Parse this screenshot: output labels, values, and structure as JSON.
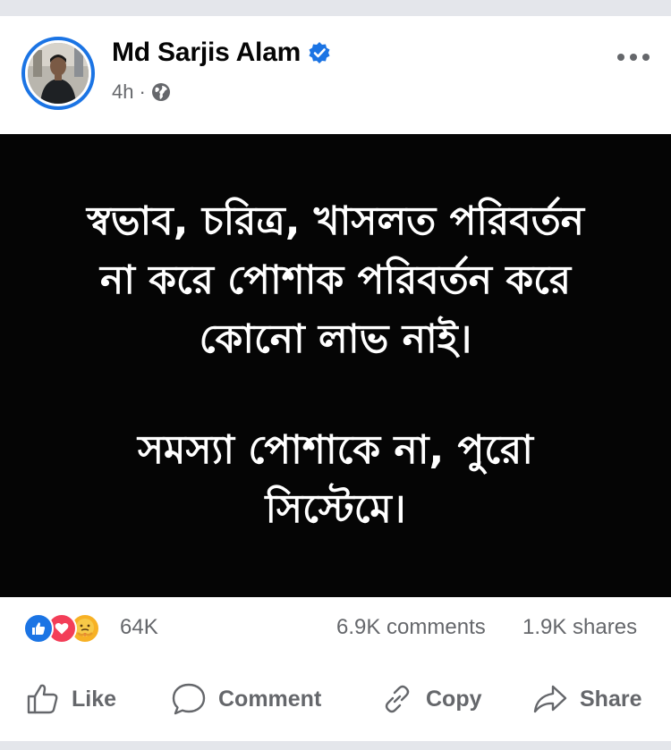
{
  "post": {
    "author": {
      "name": "Md Sarjis Alam",
      "verified": true,
      "avatar_icon": "profile-photo"
    },
    "time": "4h",
    "separator": "·",
    "audience_icon": "globe-icon",
    "more_icon": "more-dots-icon",
    "image_text": {
      "paragraph1": "স্বভাব, চরিত্র, খাসলত পরিবর্তন\nনা করে পোশাক পরিবর্তন করে\nকোনো লাভ নাই।",
      "paragraph2": "সমস্যা পোশাকে না, পুরো\nসিস্টেমে।"
    },
    "image_colors": {
      "background": "#050505",
      "text": "#ffffff"
    }
  },
  "stats": {
    "reactions": [
      "like-icon",
      "love-icon",
      "care-icon"
    ],
    "reaction_count": "64K",
    "comments": "6.9K comments",
    "shares": "1.9K shares"
  },
  "actions": {
    "like": "Like",
    "comment": "Comment",
    "copy": "Copy",
    "share": "Share"
  },
  "colors": {
    "accent": "#1b74e4",
    "muted_text": "#65676b",
    "love": "#f33e58",
    "care": "#f7b125"
  }
}
